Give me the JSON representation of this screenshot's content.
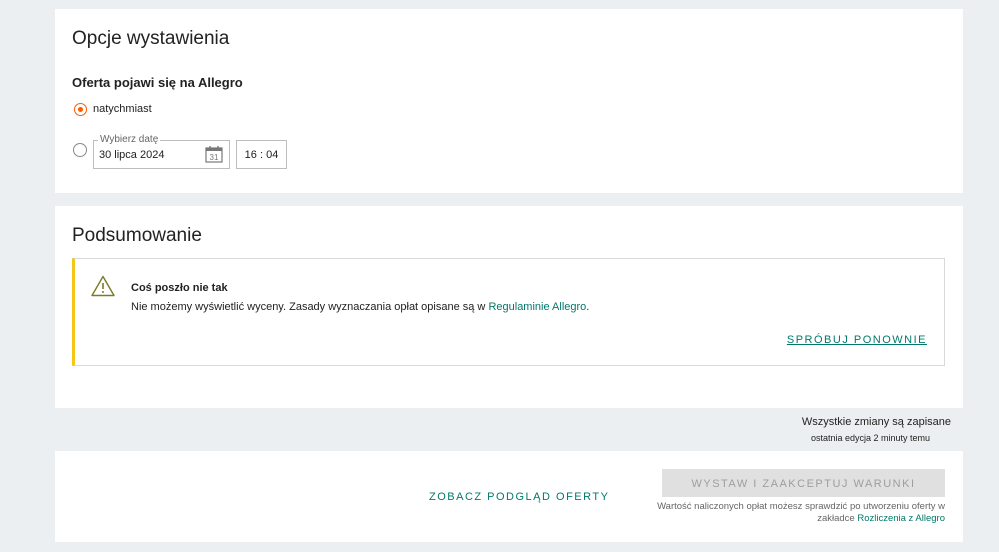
{
  "listing_options": {
    "title": "Opcje wystawienia",
    "subtitle": "Oferta pojawi się na Allegro",
    "option_now_label": "natychmiast",
    "date_field": {
      "legend": "Wybierz datę",
      "value": "30 lipca 2024",
      "icon_day": "31"
    },
    "time_value": "16 : 04"
  },
  "summary": {
    "title": "Podsumowanie",
    "alert": {
      "title": "Coś poszło nie tak",
      "message": "Nie możemy wyświetlić wyceny. Zasady wyznaczania opłat opisane są w",
      "link": "Regulaminie Allegro",
      "end": ".",
      "retry": "SPRÓBUJ PONOWNIE",
      "accent": "#f5c518"
    }
  },
  "save_status": {
    "text": "Wszystkie zmiany są zapisane",
    "sub": "ostatnia edycja 2 minuty temu"
  },
  "footer": {
    "preview_link": "ZOBACZ PODGLĄD OFERTY",
    "accept_button": "WYSTAW I ZAAKCEPTUJ WARUNKI",
    "note_text": "Wartość naliczonych opłat możesz sprawdzić po utworzeniu oferty w zakładce",
    "note_link": "Rozliczenia z Allegro"
  },
  "colors": {
    "accent": "#ff5a00",
    "link": "#00796b",
    "warning": "#f5c518"
  }
}
